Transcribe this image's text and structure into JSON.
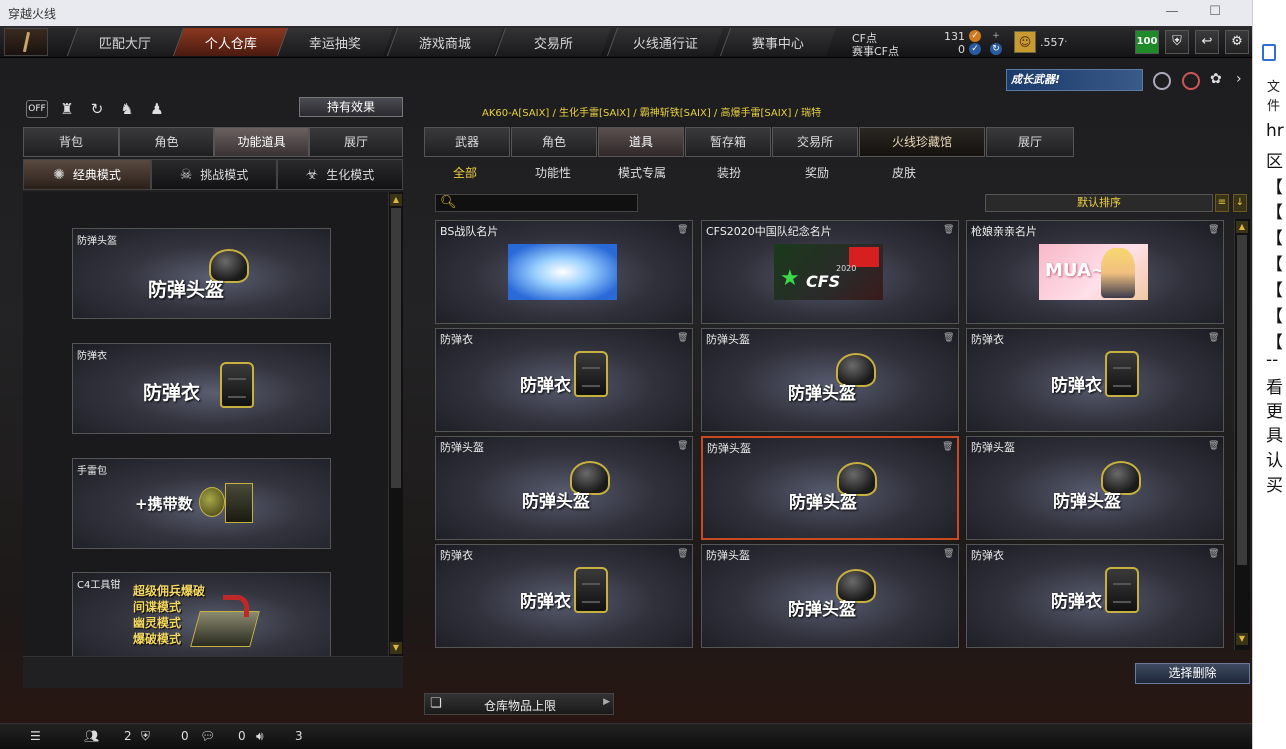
{
  "window": {
    "title": "穿越火线",
    "controls": [
      "—",
      "☐",
      "✕"
    ]
  },
  "topnav": {
    "tabs": [
      "匹配大厅",
      "个人仓库",
      "幸运抽奖",
      "游戏商城",
      "交易所",
      "火线通行证",
      "赛事中心"
    ],
    "active_tab": "个人仓库",
    "cf_label": "CF点",
    "cf_value": "131",
    "event_cf_label": "赛事CF点",
    "event_cf_value": "0",
    "level_value": ".557",
    "level_suffix": "·",
    "badge_value": "100",
    "colors": {
      "active": "#8a3820",
      "badge": "#1e8a2a",
      "accent": "#f0d040"
    }
  },
  "left": {
    "icons": [
      "off-toggle-icon",
      "trophy-icon",
      "refresh-icon",
      "character-icon",
      "mascot-icon"
    ],
    "effect_button": "持有效果",
    "tabs": [
      "背包",
      "角色",
      "功能道具",
      "展厅"
    ],
    "active_tab": "功能道具",
    "modes": [
      {
        "label": "经典模式",
        "icon": "burst-icon"
      },
      {
        "label": "挑战模式",
        "icon": "skull-icon"
      },
      {
        "label": "生化模式",
        "icon": "biohazard-icon"
      }
    ],
    "active_mode": "经典模式",
    "items": [
      {
        "name": "防弹头盔",
        "big": "防弹头盔",
        "type": "helmet"
      },
      {
        "name": "防弹衣",
        "big": "防弹衣",
        "type": "vest"
      },
      {
        "name": "手雷包",
        "big": "+携带数",
        "type": "grenade"
      },
      {
        "name": "C4工具钳",
        "lines": [
          "超级佣兵爆破",
          "间谍模式",
          "幽灵模式",
          "爆破模式"
        ],
        "type": "c4"
      }
    ]
  },
  "right": {
    "path": "AK60-A[SAIX] / 生化手雷[SAIX] / 霸神斩铁[SAIX] / 高爆手雷[SAIX] / 瑞特",
    "tabs": [
      "武器",
      "角色",
      "道具",
      "暂存箱",
      "交易所",
      "火线珍藏馆",
      "展厅"
    ],
    "active_tab": "道具",
    "subtabs": [
      "全部",
      "功能性",
      "模式专属",
      "装扮",
      "奖励",
      "皮肤"
    ],
    "active_subtab": "全部",
    "search_placeholder": "",
    "sort_label": "默认排序",
    "cards": [
      {
        "name": "BS战队名片",
        "kind": "card-bs"
      },
      {
        "name": "CFS2020中国队纪念名片",
        "kind": "card-cfs",
        "logo_text": "CFS",
        "logo_year": "2020"
      },
      {
        "name": "枪娘亲亲名片",
        "kind": "card-mua",
        "logo_text": "MUA~"
      },
      {
        "name": "防弹衣",
        "big": "防弹衣",
        "kind": "vest"
      },
      {
        "name": "防弹头盔",
        "big": "防弹头盔",
        "kind": "helmet"
      },
      {
        "name": "防弹衣",
        "big": "防弹衣",
        "kind": "vest"
      },
      {
        "name": "防弹头盔",
        "big": "防弹头盔",
        "kind": "helmet"
      },
      {
        "name": "防弹头盔",
        "big": "防弹头盔",
        "kind": "helmet",
        "selected": true
      },
      {
        "name": "防弹头盔",
        "big": "防弹头盔",
        "kind": "helmet"
      },
      {
        "name": "防弹衣",
        "big": "防弹衣",
        "kind": "vest"
      },
      {
        "name": "防弹头盔",
        "big": "防弹头盔",
        "kind": "helmet"
      },
      {
        "name": "防弹衣",
        "big": "防弹衣",
        "kind": "vest"
      }
    ],
    "delete_button": "选择删除",
    "capacity_button": "仓库物品上限",
    "banner_text": "成长武器!"
  },
  "statusbar": {
    "friends": "2",
    "shield": "0",
    "chat": "0",
    "volume": "3"
  },
  "docpanel": {
    "wen": "文件",
    "lines": [
      "hr",
      "区",
      "【",
      "【",
      "【",
      "【",
      "【",
      "【",
      "【",
      "--",
      "看",
      "更",
      "具",
      "认",
      "买"
    ]
  }
}
